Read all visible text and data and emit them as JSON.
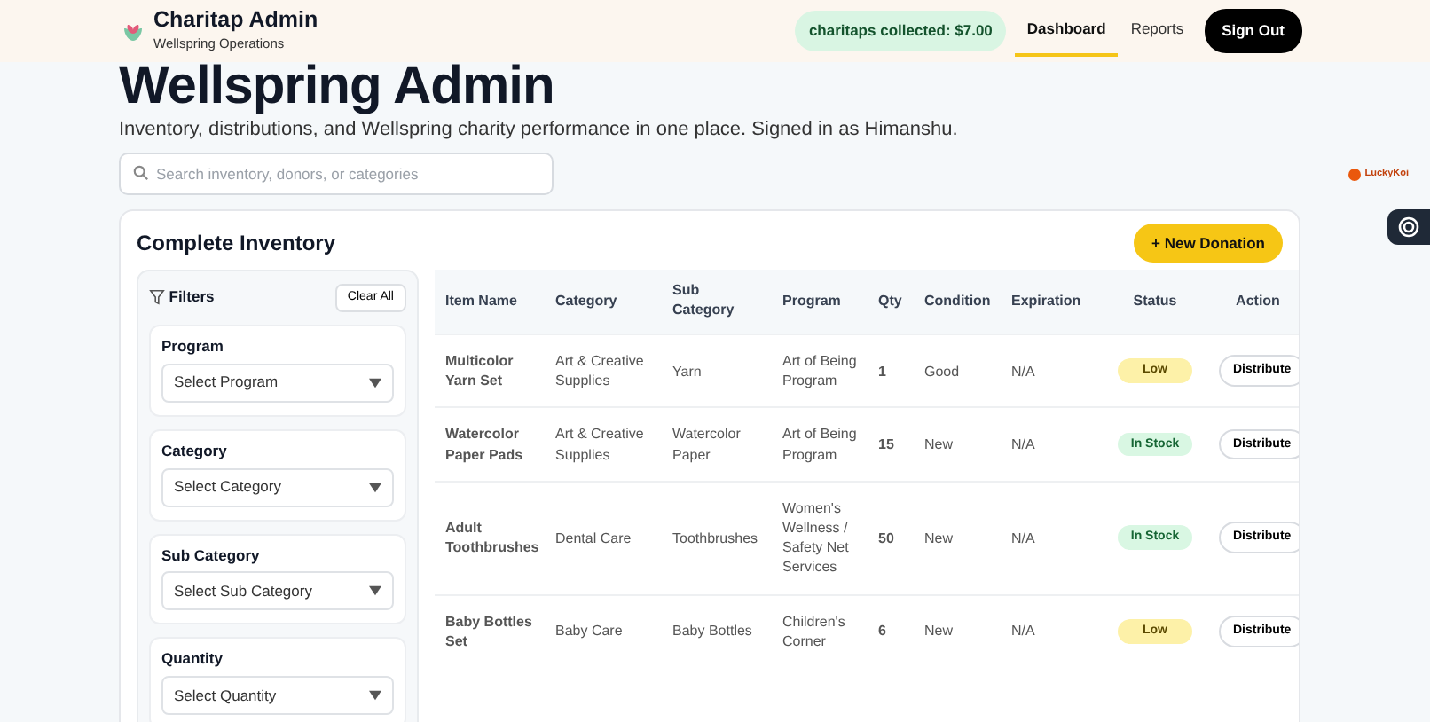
{
  "header": {
    "brand": "Charitap Admin",
    "subtitle": "Wellspring Operations",
    "collected": "charitaps collected: $7.00",
    "nav": [
      {
        "label": "Dashboard",
        "selected": true
      },
      {
        "label": "Reports",
        "selected": false
      }
    ],
    "sign_out": "Sign Out"
  },
  "page": {
    "title": "Wellspring Admin",
    "description": "Inventory, distributions, and Wellspring charity performance in one place. Signed in as Himanshu.",
    "search": {
      "placeholder": "Search inventory, donors, or categories"
    }
  },
  "extension_badge": "LuckyKoi",
  "inventory": {
    "title": "Complete Inventory",
    "new_button": "+ New Donation",
    "filters": {
      "title": "Filters",
      "clear": "Clear All",
      "groups": [
        {
          "label": "Program",
          "placeholder": "Select Program"
        },
        {
          "label": "Category",
          "placeholder": "Select Category"
        },
        {
          "label": "Sub Category",
          "placeholder": "Select Sub Category"
        },
        {
          "label": "Quantity",
          "placeholder": "Select Quantity"
        }
      ]
    },
    "table": {
      "columns": [
        "Item Name",
        "Category",
        "Sub Category",
        "Program",
        "Qty",
        "Condition",
        "Expiration",
        "Status",
        "Action"
      ],
      "rows": [
        {
          "item": "Multicolor Yarn Set",
          "category": "Art & Creative Supplies",
          "sub_category": "Yarn",
          "program": "Art of Being Program",
          "qty": "1",
          "condition": "Good",
          "expiration": "N/A",
          "status": {
            "label": "Low",
            "kind": "low"
          },
          "action": "Distribute"
        },
        {
          "item": "Watercolor Paper Pads",
          "category": "Art & Creative Supplies",
          "sub_category": "Watercolor Paper",
          "program": "Art of Being Program",
          "qty": "15",
          "condition": "New",
          "expiration": "N/A",
          "status": {
            "label": "In Stock",
            "kind": "in-stock"
          },
          "action": "Distribute"
        },
        {
          "item": "Adult Toothbrushes",
          "category": "Dental Care",
          "sub_category": "Toothbrushes",
          "program": "Women's Wellness / Safety Net Services",
          "qty": "50",
          "condition": "New",
          "expiration": "N/A",
          "status": {
            "label": "In Stock",
            "kind": "in-stock"
          },
          "action": "Distribute"
        },
        {
          "item": "Baby Bottles Set",
          "category": "Baby Care",
          "sub_category": "Baby Bottles",
          "program": "Children's Corner",
          "qty": "6",
          "condition": "New",
          "expiration": "N/A",
          "status": {
            "label": "Low",
            "kind": "low"
          },
          "action": "Distribute"
        }
      ]
    }
  }
}
